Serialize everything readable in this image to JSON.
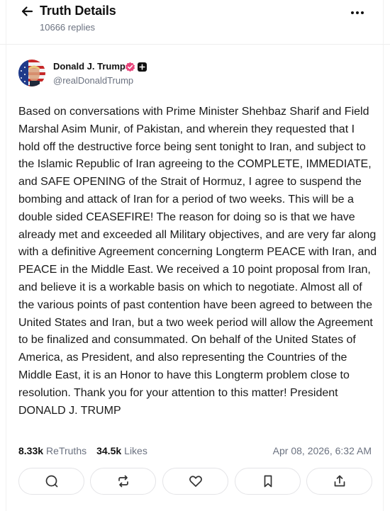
{
  "header": {
    "title": "Truth Details",
    "replies": "10666 replies"
  },
  "post": {
    "author_name": "Donald J. Trump",
    "handle": "@realDonaldTrump",
    "text": "Based on conversations with Prime Minister Shehbaz Sharif and Field Marshal Asim Munir, of Pakistan, and wherein they requested that I hold off the destructive force being sent tonight to Iran, and subject to the Islamic Republic of Iran agreeing to the COMPLETE, IMMEDIATE, and SAFE OPENING of the Strait of Hormuz, I agree to suspend the bombing and attack of Iran for a period of two weeks. This will be a double sided CEASEFIRE! The reason for doing so is that we have already met and exceeded all Military objectives, and are very far along with a definitive Agreement concerning Longterm PEACE with Iran, and PEACE in the Middle East. We received a 10 point proposal from Iran, and believe it is a workable basis on which to negotiate. Almost all of the various points of past contention have been agreed to between the United States and Iran, but a two week period will allow the Agreement to be finalized and consummated. On behalf of the United States of America, as President, and also representing the Countries of the Middle East, it is an Honor to have this Longterm problem close to resolution. Thank you for your attention to this matter! President DONALD J. TRUMP",
    "retruths_count": "8.33k",
    "retruths_label": "ReTruths",
    "likes_count": "34.5k",
    "likes_label": "Likes",
    "timestamp": "Apr 08, 2026, 6:32 AM"
  },
  "icons": {
    "back": "arrow-left-icon",
    "more": "more-horizontal-icon",
    "verified": "verified-badge-icon",
    "plus": "plus-square-icon",
    "reply": "comment-icon",
    "retruth": "repost-icon",
    "like": "heart-icon",
    "bookmark": "bookmark-icon",
    "share": "share-icon"
  },
  "colors": {
    "verified_badge": "#e8467c",
    "muted_text": "#6b7280",
    "border": "#e4e4e7"
  }
}
